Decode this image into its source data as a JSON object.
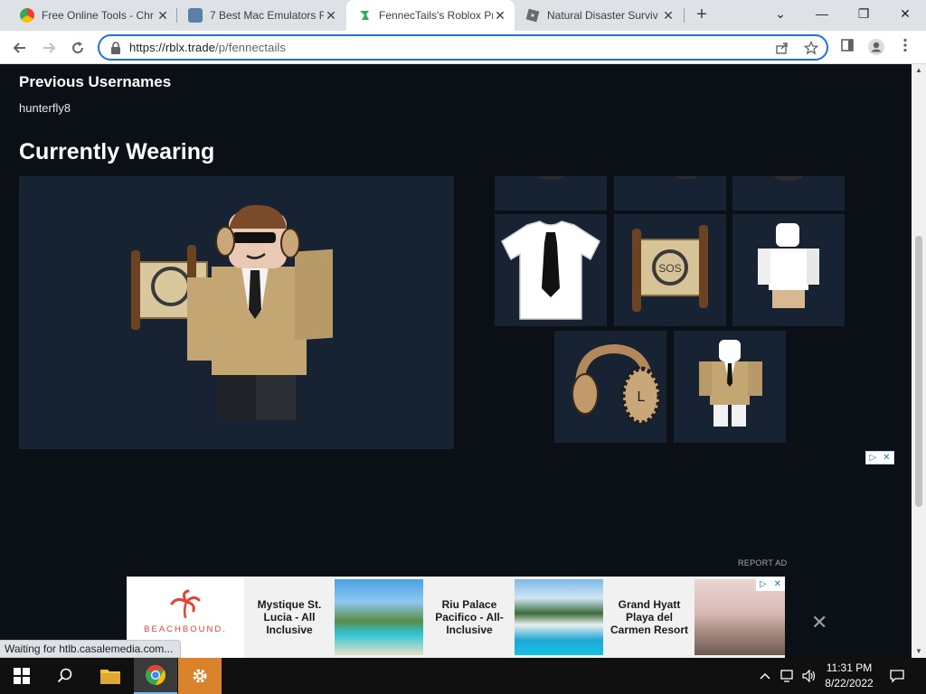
{
  "browser": {
    "tabs": [
      {
        "title": "Free Online Tools - Chr",
        "favicon": "chrome-tools-favicon",
        "active": false
      },
      {
        "title": "7 Best Mac Emulators F",
        "favicon": "mac-emulators-favicon",
        "active": false
      },
      {
        "title": "FennecTails's Roblox Pr",
        "favicon": "rblx-trade-favicon",
        "active": true
      },
      {
        "title": "Natural Disaster Surviv",
        "favicon": "roblox-favicon",
        "active": false
      }
    ],
    "new_tab_glyph": "+",
    "window_controls": {
      "minimize": "—",
      "maximize": "❐",
      "close": "✕",
      "dropdown": "⌄"
    },
    "address": {
      "host": "https://rblx.trade",
      "path": "/p/fennectails"
    }
  },
  "page": {
    "previous_usernames_heading": "Previous Usernames",
    "previous_username": "hunterfly8",
    "currently_wearing_heading": "Currently Wearing",
    "items": [
      {
        "name": "hat-item-top-left",
        "cut": true
      },
      {
        "name": "hat-item-top-middle",
        "cut": true
      },
      {
        "name": "hat-item-top-right",
        "cut": true
      },
      {
        "name": "tie-shirt-item"
      },
      {
        "name": "sos-scroll-item"
      },
      {
        "name": "white-body-item"
      },
      {
        "name": "headphones-item"
      },
      {
        "name": "tan-suit-item"
      }
    ],
    "report_ad": "REPORT AD"
  },
  "ad": {
    "brand_logo_text": "BEACHBOUND.",
    "deals": [
      {
        "title": "Mystique St. Lucia - All Inclusive"
      },
      {
        "title": "Riu Palace Pacifico - All-Inclusive"
      },
      {
        "title": "Grand Hyatt Playa del Carmen Resort"
      }
    ],
    "close_glyph": "✕"
  },
  "status_bar": "Waiting for htlb.casalemedia.com...",
  "taskbar": {
    "time": "11:31 PM",
    "date": "8/22/2022"
  },
  "colors": {
    "page_bg": "#0b1016",
    "panel_bg": "#172333",
    "accent": "#1a73e8"
  }
}
